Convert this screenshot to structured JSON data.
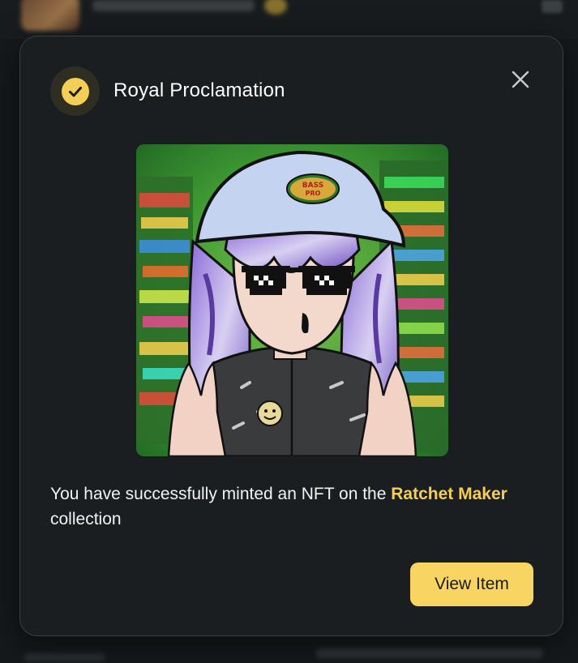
{
  "background": {
    "blurred": true
  },
  "modal": {
    "status_icon": "check-circle-icon",
    "title": "Royal Proclamation",
    "close_icon": "close-icon",
    "image_alt": "NFT artwork",
    "message": {
      "prefix": "You have successfully minted an NFT on the ",
      "collection_name": "Ratchet Maker",
      "suffix": " collection"
    },
    "view_button_label": "View Item"
  },
  "colors": {
    "accent": "#f5cf55",
    "modal_bg": "#1a1e20",
    "page_bg": "#141719",
    "button_bg": "#f8d563"
  }
}
